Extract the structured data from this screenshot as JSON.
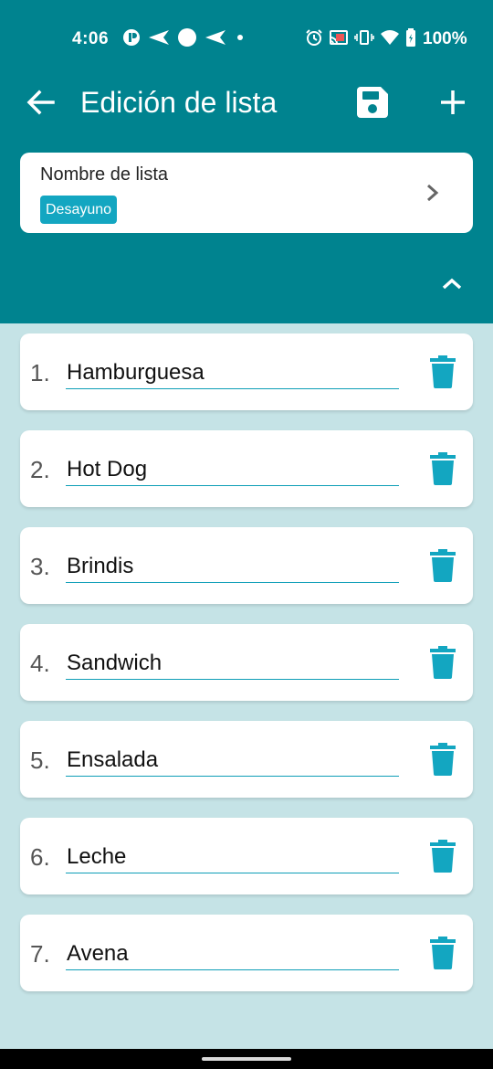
{
  "status": {
    "time": "4:06",
    "battery": "100%",
    "left_icons": [
      "app-notification-icon",
      "send-icon",
      "circle-icon",
      "send-icon",
      "dot-icon"
    ],
    "right_icons": [
      "alarm-icon",
      "cast-icon",
      "vibrate-icon",
      "wifi-icon",
      "battery-icon"
    ]
  },
  "toolbar": {
    "title": "Edición de lista",
    "back_icon": "arrow-left-icon",
    "save_icon": "save-icon",
    "add_icon": "plus-icon"
  },
  "list_name": {
    "label": "Nombre de lista",
    "value": "Desayuno"
  },
  "items": [
    {
      "number": "1.",
      "value": "Hamburguesa"
    },
    {
      "number": "2.",
      "value": "Hot Dog"
    },
    {
      "number": "3.",
      "value": "Brindis"
    },
    {
      "number": "4.",
      "value": "Sandwich"
    },
    {
      "number": "5.",
      "value": "Ensalada"
    },
    {
      "number": "6.",
      "value": "Leche"
    },
    {
      "number": "7.",
      "value": "Avena"
    }
  ],
  "colors": {
    "header": "#00838f",
    "background": "#c5e3e6",
    "accent": "#13a6c1"
  }
}
